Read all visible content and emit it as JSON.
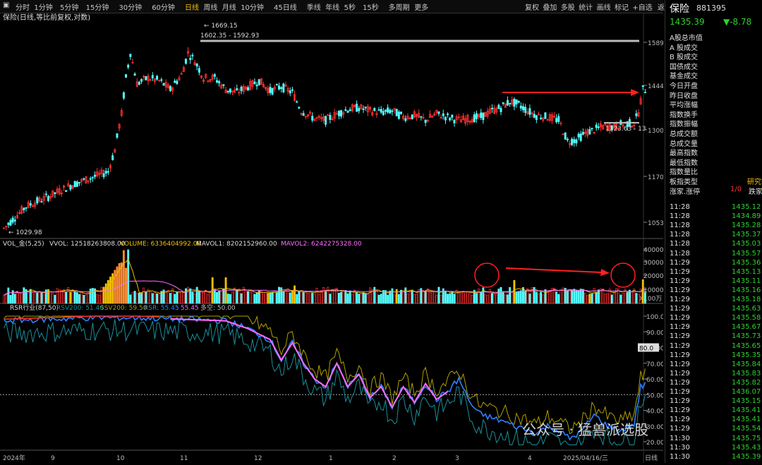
{
  "toolbar": {
    "left_items": [
      "分时",
      "1分钟",
      "5分钟",
      "15分钟",
      "30分钟",
      "60分钟",
      "日线",
      "周线",
      "月线",
      "10分钟",
      "45日线",
      "季线",
      "年线",
      "5秒",
      "15秒",
      "多周期",
      "更多"
    ],
    "active": "日线",
    "right_items": [
      "复权",
      "叠加",
      "多股",
      "统计",
      "画线",
      "标记",
      "+自选",
      "返回"
    ]
  },
  "main_chart": {
    "title": "保险(日线,等比前复权,对数)",
    "y_ticks": [
      "1589",
      "1444",
      "1300",
      "1170",
      "1053"
    ],
    "annotations": {
      "high_label": "1669.15",
      "range_label": "1602.35 - 1592.93",
      "low_label": "1029.98",
      "recent_label": "1323.63 - 13"
    }
  },
  "volume_panel": {
    "header": {
      "name": "VOL_金(5,25)",
      "vvol": "VVOL: 12518263808.00",
      "volume": "VOLUME: 6336404992.00",
      "mavol1": "MAVOL1: 8202152960.00",
      "mavol2": "MAVOL2: 6242275328.00"
    },
    "y_ticks": [
      "40000",
      "30000",
      "20000",
      "10000"
    ],
    "unit": "X100万"
  },
  "rsr_panel": {
    "header": {
      "name": "RSR行业(87,50)",
      "rsv200": "RSV200: 51.40",
      "ssv200": "SSV200: 59.50",
      "rsr": "RSR: 55.45",
      "rsr2": ": 55.45",
      "duo": "多空: 50.00"
    },
    "y_ticks": [
      "100.0",
      "90.00",
      "80.00",
      "70.00",
      "60.00",
      "50.00",
      "40.00",
      "30.00",
      "20.00"
    ],
    "marker": "80.0"
  },
  "x_axis": {
    "labels": [
      "2024年",
      "9",
      "10",
      "11",
      "12",
      "1",
      "2",
      "3",
      "4",
      "2025/04/16/三",
      "日线"
    ]
  },
  "watermark": {
    "text": "公众号 · 猛兽派选股"
  },
  "right_panel": {
    "name": "保险",
    "code": "881395",
    "price": "1435.39",
    "change": "▼-8.78",
    "fields": [
      "A股总市值",
      "A 股成交",
      "B 股成交",
      "国债成交",
      "基金成交",
      "今日开盘",
      "昨日收盘",
      "平均涨幅",
      "指数换手",
      "指数振幅",
      "总成交额",
      "总成交量",
      "最高指数",
      "最低指数",
      "指数量比",
      "板指类型",
      "涨家.涨停"
    ],
    "board_type_value": "研究行",
    "up_ratio": "1/0",
    "down_label": "跌家",
    "ticks": [
      [
        "11:28",
        "1435.12"
      ],
      [
        "11:28",
        "1434.89"
      ],
      [
        "11:28",
        "1435.28"
      ],
      [
        "11:28",
        "1435.37"
      ],
      [
        "11:28",
        "1435.03"
      ],
      [
        "11:28",
        "1435.57"
      ],
      [
        "11:29",
        "1435.36"
      ],
      [
        "11:29",
        "1435.13"
      ],
      [
        "11:29",
        "1435.11"
      ],
      [
        "11:29",
        "1435.16"
      ],
      [
        "11:29",
        "1435.18"
      ],
      [
        "11:29",
        "1435.63"
      ],
      [
        "11:29",
        "1435.58"
      ],
      [
        "11:29",
        "1435.67"
      ],
      [
        "11:29",
        "1435.73"
      ],
      [
        "11:29",
        "1435.65"
      ],
      [
        "11:29",
        "1435.35"
      ],
      [
        "11:29",
        "1435.84"
      ],
      [
        "11:29",
        "1435.83"
      ],
      [
        "11:29",
        "1435.82"
      ],
      [
        "11:29",
        "1436.07"
      ],
      [
        "11:29",
        "1435.15"
      ],
      [
        "11:29",
        "1435.41"
      ],
      [
        "11:29",
        "1435.41"
      ],
      [
        "11:29",
        "1435.54"
      ],
      [
        "11:30",
        "1435.75"
      ],
      [
        "11:30",
        "1435.43"
      ],
      [
        "11:30",
        "1435.39"
      ]
    ]
  },
  "colors": {
    "up": "#ff3030",
    "down": "#54ffff",
    "yellow": "#f0c000",
    "orange": "#ff8c30",
    "white": "#ffffff",
    "magenta": "#ff6cff",
    "olive": "#b0a000",
    "teal": "#1a8f9a",
    "blue": "#3080ff",
    "arrow": "#ff2020",
    "green": "#2fd12f"
  }
}
